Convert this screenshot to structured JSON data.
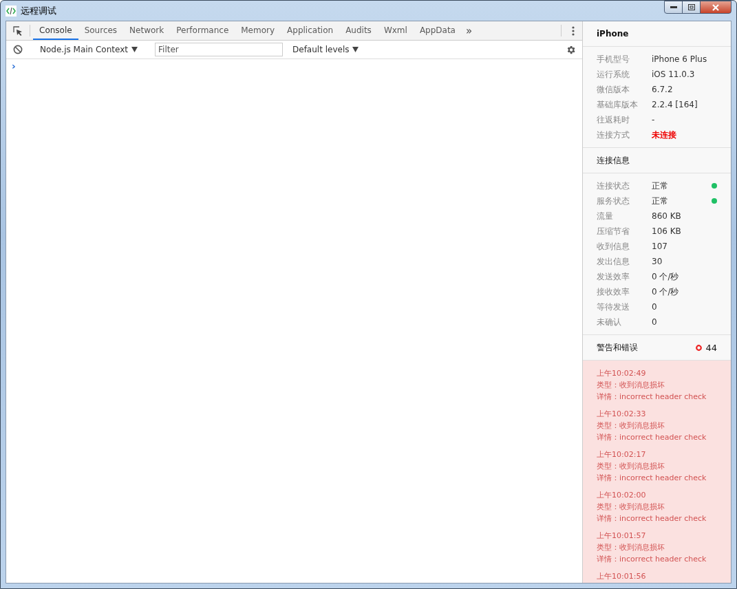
{
  "window": {
    "title": "远程调试"
  },
  "tabs": [
    {
      "label": "Console",
      "selected": true
    },
    {
      "label": "Sources",
      "selected": false
    },
    {
      "label": "Network",
      "selected": false
    },
    {
      "label": "Performance",
      "selected": false
    },
    {
      "label": "Memory",
      "selected": false
    },
    {
      "label": "Application",
      "selected": false
    },
    {
      "label": "Audits",
      "selected": false
    },
    {
      "label": "Wxml",
      "selected": false
    },
    {
      "label": "AppData",
      "selected": false
    }
  ],
  "more_tabs": "»",
  "console_toolbar": {
    "context": "Node.js Main Context",
    "filter": {
      "placeholder": "Filter"
    },
    "levels": "Default levels"
  },
  "prompt": "›",
  "device": {
    "title": "iPhone",
    "rows": [
      {
        "label": "手机型号",
        "value": "iPhone 6 Plus",
        "kind": "plain"
      },
      {
        "label": "运行系统",
        "value": "iOS 11.0.3",
        "kind": "plain"
      },
      {
        "label": "微信版本",
        "value": "6.7.2",
        "kind": "plain"
      },
      {
        "label": "基础库版本",
        "value": "2.2.4 [164]",
        "kind": "plain"
      },
      {
        "label": "往返耗时",
        "value": "-",
        "kind": "plain"
      },
      {
        "label": "连接方式",
        "value": "未连接",
        "kind": "alert"
      }
    ]
  },
  "connection": {
    "title": "连接信息",
    "rows": [
      {
        "label": "连接状态",
        "value": "正常",
        "color": "#1fc065"
      },
      {
        "label": "服务状态",
        "value": "正常",
        "color": "#1fc065"
      },
      {
        "label": "流量",
        "value": "860 KB"
      },
      {
        "label": "压缩节省",
        "value": "106 KB"
      },
      {
        "label": "收到信息",
        "value": "107"
      },
      {
        "label": "发出信息",
        "value": "30"
      },
      {
        "label": "发送效率",
        "value": "0 个/秒"
      },
      {
        "label": "接收效率",
        "value": "0 个/秒"
      },
      {
        "label": "等待发送",
        "value": "0"
      },
      {
        "label": "未确认",
        "value": "0"
      }
    ]
  },
  "warnings": {
    "title": "警告和错误",
    "count": "44",
    "entries": [
      {
        "time": "上午10:02:49",
        "type": "类型：收到消息损坏",
        "detail": "详情：incorrect header check"
      },
      {
        "time": "上午10:02:33",
        "type": "类型：收到消息损坏",
        "detail": "详情：incorrect header check"
      },
      {
        "time": "上午10:02:17",
        "type": "类型：收到消息损坏",
        "detail": "详情：incorrect header check"
      },
      {
        "time": "上午10:02:00",
        "type": "类型：收到消息损坏",
        "detail": "详情：incorrect header check"
      },
      {
        "time": "上午10:01:57",
        "type": "类型：收到消息损坏",
        "detail": "详情：incorrect header check"
      },
      {
        "time": "上午10:01:56"
      }
    ]
  }
}
